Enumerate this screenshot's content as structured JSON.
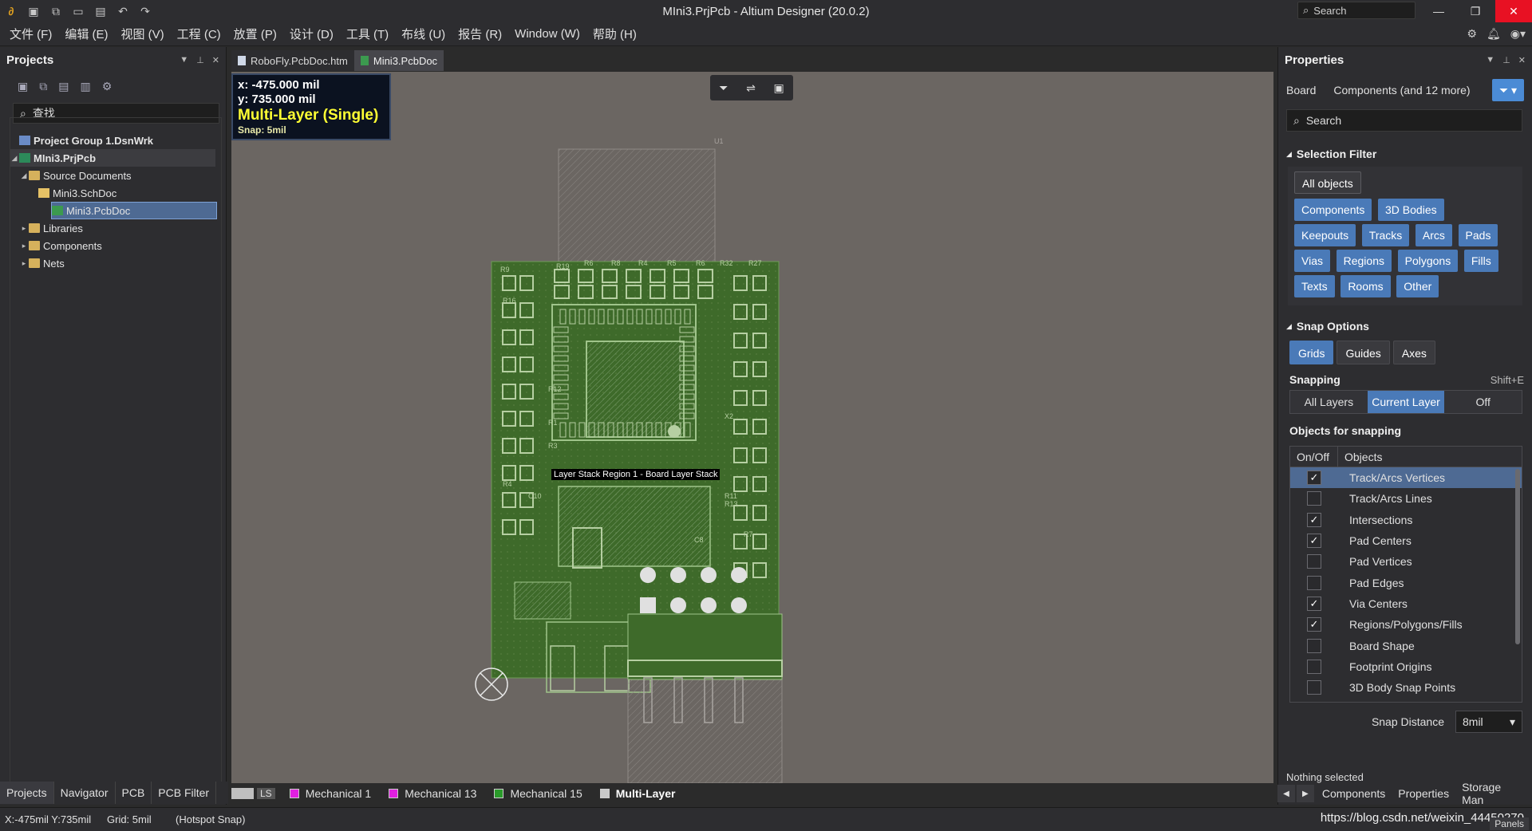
{
  "window": {
    "title": "MIni3.PrjPcb - Altium Designer (20.0.2)",
    "search_placeholder": "Search",
    "controls": {
      "minimize": "—",
      "restore": "❐",
      "close": "✕"
    }
  },
  "quick_access": [
    "save-icon",
    "save-all-icon",
    "open-icon",
    "open-project-icon",
    "undo-icon",
    "redo-icon"
  ],
  "menu": {
    "items": [
      "文件 (F)",
      "编辑 (E)",
      "视图 (V)",
      "工程 (C)",
      "放置 (P)",
      "设计 (D)",
      "工具 (T)",
      "布线 (U)",
      "报告 (R)",
      "Window (W)",
      "帮助 (H)"
    ]
  },
  "projects_panel": {
    "title": "Projects",
    "search_placeholder": "查找",
    "tree": {
      "group": "Project Group 1.DsnWrk",
      "project": "MIni3.PrjPcb",
      "source_documents": "Source Documents",
      "schdoc": "Mini3.SchDoc",
      "pcbdoc": "Mini3.PcbDoc",
      "libraries": "Libraries",
      "components": "Components",
      "nets": "Nets"
    },
    "bottom_tabs": [
      "Projects",
      "Navigator",
      "PCB",
      "PCB Filter"
    ]
  },
  "document_tabs": [
    "RoboFly.PcbDoc.htm",
    "Mini3.PcbDoc"
  ],
  "canvas": {
    "hud": {
      "x": "x:  -475.000 mil",
      "y": "y:   735.000 mil",
      "mode": "Multi-Layer (Single)",
      "snap": "Snap: 5mil"
    },
    "region_label": "Layer Stack Region 1 - Board Layer Stack",
    "designators": [
      "R9",
      "R19",
      "R6",
      "R8",
      "R4",
      "R5",
      "R6",
      "R32",
      "R27",
      "R16",
      "R12",
      "R1",
      "R3",
      "R4",
      "C10",
      "C8",
      "R7",
      "X2",
      "R11",
      "R13",
      "U1"
    ]
  },
  "layer_tabs": {
    "ls_label": "LS",
    "layers": [
      {
        "name": "Mechanical 1",
        "color": "#e020e0"
      },
      {
        "name": "Mechanical 13",
        "color": "#e020e0"
      },
      {
        "name": "Mechanical 15",
        "color": "#2a9a2a"
      },
      {
        "name": "Multi-Layer",
        "color": "#c8c8c8"
      }
    ]
  },
  "properties_panel": {
    "title": "Properties",
    "board_label": "Board",
    "components_label": "Components (and 12 more)",
    "search_placeholder": "Search",
    "selection_filter": {
      "title": "Selection Filter",
      "all_objects": "All objects",
      "chips": [
        "Components",
        "3D Bodies",
        "Keepouts",
        "Tracks",
        "Arcs",
        "Pads",
        "Vias",
        "Regions",
        "Polygons",
        "Fills",
        "Texts",
        "Rooms",
        "Other"
      ]
    },
    "snap_options": {
      "title": "Snap Options",
      "toggles": [
        "Grids",
        "Guides",
        "Axes"
      ],
      "snapping_label": "Snapping",
      "snapping_shortcut": "Shift+E",
      "snapping_modes": [
        "All Layers",
        "Current Layer",
        "Off"
      ],
      "objects_title": "Objects for snapping",
      "col_onoff": "On/Off",
      "col_objects": "Objects",
      "objects": [
        {
          "name": "Track/Arcs Vertices",
          "checked": true,
          "selected": true
        },
        {
          "name": "Track/Arcs Lines",
          "checked": false
        },
        {
          "name": "Intersections",
          "checked": true
        },
        {
          "name": "Pad Centers",
          "checked": true
        },
        {
          "name": "Pad Vertices",
          "checked": false
        },
        {
          "name": "Pad Edges",
          "checked": false
        },
        {
          "name": "Via Centers",
          "checked": true
        },
        {
          "name": "Regions/Polygons/Fills",
          "checked": true
        },
        {
          "name": "Board Shape",
          "checked": false
        },
        {
          "name": "Footprint Origins",
          "checked": false
        },
        {
          "name": "3D Body Snap Points",
          "checked": false
        }
      ],
      "snap_distance_label": "Snap Distance",
      "snap_distance": "8mil"
    },
    "nothing_selected": "Nothing selected",
    "bottom_tabs": [
      "Components",
      "Properties",
      "Storage Man"
    ]
  },
  "statusbar": {
    "coords": "X:-475mil Y:735mil",
    "grid": "Grid: 5mil",
    "snap": "(Hotspot Snap)",
    "watermark": "https://blog.csdn.net/weixin_44450270",
    "panels": "Panels"
  }
}
